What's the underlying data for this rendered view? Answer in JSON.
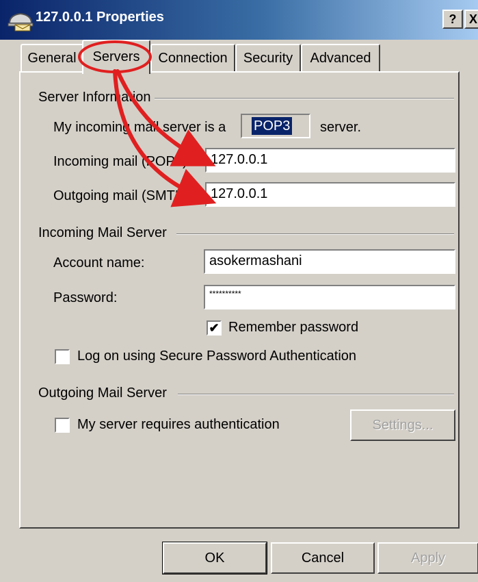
{
  "window": {
    "title": "127.0.0.1 Properties",
    "help_label": "?",
    "close_label": "X"
  },
  "tabs": [
    {
      "label": "General"
    },
    {
      "label": "Servers"
    },
    {
      "label": "Connection"
    },
    {
      "label": "Security"
    },
    {
      "label": "Advanced"
    }
  ],
  "server_info": {
    "heading": "Server Information",
    "incoming_prefix": "My incoming mail server is a",
    "protocol": "POP3",
    "incoming_suffix": "server.",
    "incoming_label": "Incoming mail (POP3):",
    "incoming_value": "127.0.0.1",
    "outgoing_label": "Outgoing mail (SMTP):",
    "outgoing_value": "127.0.0.1"
  },
  "incoming_server": {
    "heading": "Incoming Mail Server",
    "account_label": "Account name:",
    "account_value": "asokermashani",
    "password_label": "Password:",
    "password_value": "**********",
    "remember_label": "Remember password",
    "remember_checked": true,
    "spa_label": "Log on using Secure Password Authentication",
    "spa_checked": false
  },
  "outgoing_server": {
    "heading": "Outgoing Mail Server",
    "auth_label": "My server requires authentication",
    "auth_checked": false,
    "settings_label": "Settings..."
  },
  "buttons": {
    "ok": "OK",
    "cancel": "Cancel",
    "apply": "Apply"
  },
  "colors": {
    "annotation": "#e02020",
    "selection": "#0a246a",
    "dialog_bg": "#d4d0c8"
  }
}
